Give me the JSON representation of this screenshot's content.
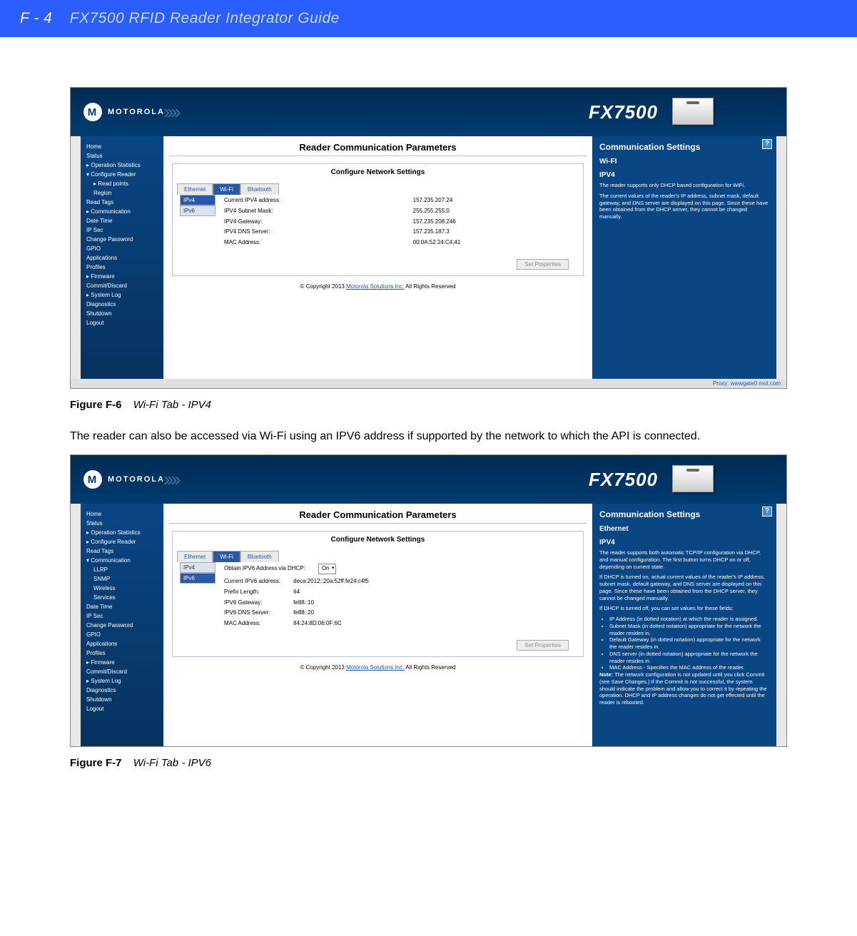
{
  "header": {
    "page_number": "F - 4",
    "doc_title": "FX7500 RFID Reader Integrator Guide"
  },
  "caption1": {
    "num": "Figure F-6",
    "title": "Wi-Fi Tab - IPV4"
  },
  "para1": "The reader can also be accessed via Wi-Fi using an IPV6 address if supported by the network to which the API is connected.",
  "caption2": {
    "num": "Figure F-7",
    "title": "Wi-Fi Tab - IPV6"
  },
  "brand": {
    "logo_text": "MOTOROLA",
    "model": "FX7500"
  },
  "common": {
    "main_title": "Reader Communication Parameters",
    "panel_title": "Configure Network Settings",
    "tabs": {
      "ethernet": "Ethernet",
      "wifi": "Wi-Fi",
      "bluetooth": "Bluetooth"
    },
    "iptabs": {
      "ipv4": "IPv4",
      "ipv6": "IPv6"
    },
    "set_properties": "Set Properties",
    "copyright_prefix": "© Copyright 2013 ",
    "copyright_link": "Motorola Solutions Inc.",
    "copyright_suffix": " All Rights Reserved",
    "proxy": "Proxy: wwwgate0.mot.com"
  },
  "sidebar1": [
    {
      "t": "Home"
    },
    {
      "t": "Status"
    },
    {
      "t": "▸ Operation Statistics"
    },
    {
      "t": "▾ Configure Reader"
    },
    {
      "t": "▸ Read points",
      "sub": true
    },
    {
      "t": "Region",
      "sub": true
    },
    {
      "t": "Read Tags"
    },
    {
      "t": "▸ Communication"
    },
    {
      "t": "Date Time"
    },
    {
      "t": "IP Sec"
    },
    {
      "t": "Change Password"
    },
    {
      "t": "GPIO"
    },
    {
      "t": "Applications"
    },
    {
      "t": "Profiles"
    },
    {
      "t": "▸ Firmware"
    },
    {
      "t": "Commit/Discard"
    },
    {
      "t": "▸ System Log"
    },
    {
      "t": "Diagnostics"
    },
    {
      "t": "Shutdown"
    },
    {
      "t": "Logout"
    }
  ],
  "sidebar2": [
    {
      "t": "Home"
    },
    {
      "t": "Status"
    },
    {
      "t": "▸ Operation Statistics"
    },
    {
      "t": "▸ Configure Reader"
    },
    {
      "t": "Read Tags"
    },
    {
      "t": "▾ Communication"
    },
    {
      "t": "LLRP",
      "sub": true
    },
    {
      "t": "SNMP",
      "sub": true
    },
    {
      "t": "Wireless",
      "sub": true
    },
    {
      "t": "Services",
      "sub": true
    },
    {
      "t": "Date Time"
    },
    {
      "t": "IP Sec"
    },
    {
      "t": "Change Password"
    },
    {
      "t": "GPIO"
    },
    {
      "t": "Applications"
    },
    {
      "t": "Profiles"
    },
    {
      "t": "▸ Firmware"
    },
    {
      "t": "Commit/Discard"
    },
    {
      "t": "▸ System Log"
    },
    {
      "t": "Diagnostics"
    },
    {
      "t": "Shutdown"
    },
    {
      "t": "Logout"
    }
  ],
  "shot1": {
    "fields": [
      {
        "k": "Current IPV4 address:",
        "v": "157.235.207.24"
      },
      {
        "k": "IPV4 Subnet Mask:",
        "v": "255.255.255.0"
      },
      {
        "k": "IPV4 Gateway:",
        "v": "157.235.208.246"
      },
      {
        "k": "IPV4 DNS Server:",
        "v": "157.235.187.3"
      },
      {
        "k": "MAC Address:",
        "v": "00:0A:52:24:C4:41"
      }
    ],
    "info": {
      "title": "Communication Settings",
      "sec1": "Wi-FI",
      "sec2": "IPV4",
      "p1": "The reader supports only DHCP based configuration for WiFi.",
      "p2": "The current values of the reader's IP address, subnet mask, default gateway, and DNS server are displayed on this page. Since these have been obtained from the DHCP server, they cannot be changed manually."
    }
  },
  "shot2": {
    "dhcp_label": "Obtain IPV6 Address via DHCP:",
    "dhcp_value": "On",
    "fields": [
      {
        "k": "Current IPV6 address:",
        "v": "deca:2012::20a:52ff:fe24:c4f5"
      },
      {
        "k": "Prefix Length:",
        "v": "64"
      },
      {
        "k": "IPV6 Gateway:",
        "v": "fe88::10"
      },
      {
        "k": "IPV6 DNS Server:",
        "v": "fe88::20"
      },
      {
        "k": "MAC Address:",
        "v": "84:24:8D:06:0F:6C"
      }
    ],
    "info": {
      "title": "Communication Settings",
      "sec1": "Ethernet",
      "sec2": "IPV4",
      "p1": "The reader supports both automatic TCP/IP configuration via DHCP, and manual configuration. The first button turns DHCP on or off, depending on current state.",
      "p2": "If DHCP is turned on, actual current values of the reader's IP address, subnet mask, default gateway, and DNS server are displayed on this page. Since these have been obtained from the DHCP server, they cannot be changed manually.",
      "p3": "If DHCP is turned off, you can set values for these fields:",
      "b1": "IP Address (in dotted notation) at which the reader is assigned.",
      "b2": "Subnet Mask (in dotted notation) appropriate for the network the reader resides in.",
      "b3": "Default Gateway (in dotted notation) appropriate for the network the reader resides in.",
      "b4": "DNS server (in dotted notation) appropriate for the network the reader resides in.",
      "b5": "MAC Address - Specifies the MAC address of the reader.",
      "note_label": "Note:",
      "note": " The network configuration is not updated until you click Commit (see Save Changes.) If the Commit is not successful, the system should indicate the problem and allow you to correct it by repeating the operation. DHCP and IP address changes do not get effected until the reader is rebooted."
    }
  }
}
